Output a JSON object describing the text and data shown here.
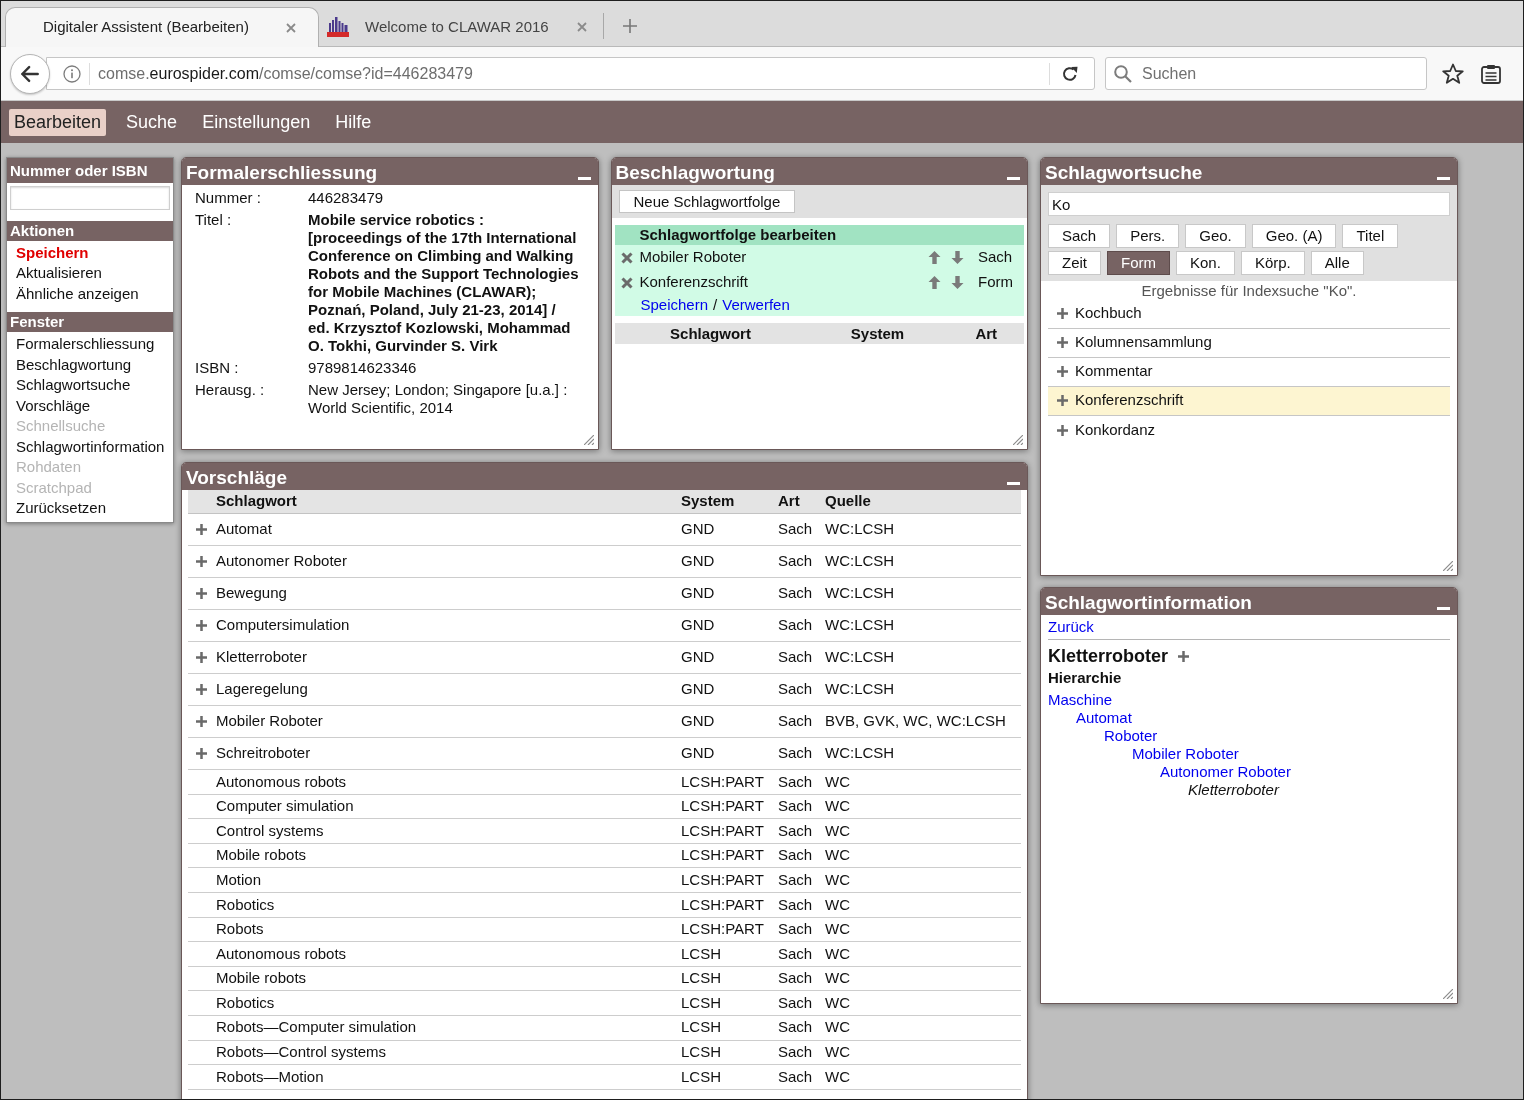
{
  "browser": {
    "tabs": [
      {
        "title": "Digitaler Assistent (Bearbeiten)",
        "selected": true,
        "favicon": false
      },
      {
        "title": "Welcome to CLAWAR 2016",
        "selected": false,
        "favicon": true
      }
    ],
    "address": {
      "subdomain": "comse.",
      "domain": "eurospider.com",
      "path": "/comse/comse?id=446283479"
    },
    "search": {
      "placeholder": "Suchen"
    }
  },
  "menu": [
    {
      "label": "Bearbeiten",
      "selected": true
    },
    {
      "label": "Suche",
      "selected": false
    },
    {
      "label": "Einstellungen",
      "selected": false
    },
    {
      "label": "Hilfe",
      "selected": false
    }
  ],
  "sidebar": {
    "lookup": {
      "title": "Nummer oder ISBN"
    },
    "sections": [
      {
        "title": "Aktionen",
        "items": [
          {
            "label": "Speichern",
            "emphasized": true,
            "disabled": false
          },
          {
            "label": "Aktualisieren",
            "emphasized": false,
            "disabled": false
          },
          {
            "label": "Ähnliche anzeigen",
            "emphasized": false,
            "disabled": false
          }
        ]
      },
      {
        "title": "Fenster",
        "items": [
          {
            "label": "Formalerschliessung",
            "emphasized": false,
            "disabled": false
          },
          {
            "label": "Beschlagwortung",
            "emphasized": false,
            "disabled": false
          },
          {
            "label": "Schlagwortsuche",
            "emphasized": false,
            "disabled": false
          },
          {
            "label": "Vorschläge",
            "emphasized": false,
            "disabled": false
          },
          {
            "label": "Schnellsuche",
            "emphasized": false,
            "disabled": true
          },
          {
            "label": "Schlagwortinformation",
            "emphasized": false,
            "disabled": false
          },
          {
            "label": "Rohdaten",
            "emphasized": false,
            "disabled": true
          },
          {
            "label": "Scratchpad",
            "emphasized": false,
            "disabled": true
          },
          {
            "label": "Zurücksetzen",
            "emphasized": false,
            "disabled": false
          }
        ]
      }
    ]
  },
  "formal": {
    "title": "Formalerschliessung",
    "fields": [
      {
        "label": "Nummer :",
        "value": "446283479",
        "bold": false
      },
      {
        "label": "Titel :",
        "value": "Mobile service robotics : [proceedings of the 17th International Conference on Climbing and Walking Robots and the Support Technologies for Mobile Machines (CLAWAR); Poznań, Poland, July 21-23, 2014] / ed. Krzysztof Kozlowski, Mohammad O. Tokhi, Gurvinder S. Virk",
        "bold": true
      },
      {
        "label": "ISBN :",
        "value": "9789814623346",
        "bold": false
      },
      {
        "label": "Herausg. :",
        "value": "New Jersey; London; Singapore [u.a.] : World Scientific, 2014",
        "bold": false
      }
    ]
  },
  "indexing": {
    "title": "Beschlagwortung",
    "new_button": "Neue Schlagwortfolge",
    "sequence": {
      "title": "Schlagwortfolge bearbeiten",
      "entries": [
        {
          "term": "Mobiler Roboter",
          "type": "Sach"
        },
        {
          "term": "Konferenzschrift",
          "type": "Form"
        }
      ],
      "save": "Speichern",
      "separator": "/",
      "discard": "Verwerfen"
    },
    "columns": [
      "Schlagwort",
      "System",
      "Art"
    ]
  },
  "keyword_search": {
    "title": "Schlagwortsuche",
    "query": "Ko",
    "filter_rows": [
      [
        {
          "label": "Sach",
          "selected": false
        },
        {
          "label": "Pers.",
          "selected": false
        },
        {
          "label": "Geo.",
          "selected": false
        },
        {
          "label": "Geo. (A)",
          "selected": false
        },
        {
          "label": "Titel",
          "selected": false
        }
      ],
      [
        {
          "label": "Zeit",
          "selected": false
        },
        {
          "label": "Form",
          "selected": true
        },
        {
          "label": "Kon.",
          "selected": false
        },
        {
          "label": "Körp.",
          "selected": false
        },
        {
          "label": "Alle",
          "selected": false
        }
      ]
    ],
    "status": "Ergebnisse für Indexsuche \"Ko\".",
    "results": [
      {
        "term": "Kochbuch",
        "selected": false
      },
      {
        "term": "Kolumnensammlung",
        "selected": false
      },
      {
        "term": "Kommentar",
        "selected": false
      },
      {
        "term": "Konferenzschrift",
        "selected": true
      },
      {
        "term": "Konkordanz",
        "selected": false
      }
    ]
  },
  "suggestions": {
    "title": "Vorschläge",
    "columns": [
      "Schlagwort",
      "System",
      "Art",
      "Quelle"
    ],
    "rows": [
      {
        "term": "Automat",
        "system": "GND",
        "type": "Sach",
        "source": "WC:LCSH",
        "addable": true
      },
      {
        "term": "Autonomer Roboter",
        "system": "GND",
        "type": "Sach",
        "source": "WC:LCSH",
        "addable": true
      },
      {
        "term": "Bewegung",
        "system": "GND",
        "type": "Sach",
        "source": "WC:LCSH",
        "addable": true
      },
      {
        "term": "Computersimulation",
        "system": "GND",
        "type": "Sach",
        "source": "WC:LCSH",
        "addable": true
      },
      {
        "term": "Kletterroboter",
        "system": "GND",
        "type": "Sach",
        "source": "WC:LCSH",
        "addable": true
      },
      {
        "term": "Lageregelung",
        "system": "GND",
        "type": "Sach",
        "source": "WC:LCSH",
        "addable": true
      },
      {
        "term": "Mobiler Roboter",
        "system": "GND",
        "type": "Sach",
        "source": "BVB, GVK, WC, WC:LCSH",
        "addable": true
      },
      {
        "term": "Schreitroboter",
        "system": "GND",
        "type": "Sach",
        "source": "WC:LCSH",
        "addable": true
      },
      {
        "term": "Autonomous robots",
        "system": "LCSH:PART",
        "type": "Sach",
        "source": "WC",
        "addable": false
      },
      {
        "term": "Computer simulation",
        "system": "LCSH:PART",
        "type": "Sach",
        "source": "WC",
        "addable": false
      },
      {
        "term": "Control systems",
        "system": "LCSH:PART",
        "type": "Sach",
        "source": "WC",
        "addable": false
      },
      {
        "term": "Mobile robots",
        "system": "LCSH:PART",
        "type": "Sach",
        "source": "WC",
        "addable": false
      },
      {
        "term": "Motion",
        "system": "LCSH:PART",
        "type": "Sach",
        "source": "WC",
        "addable": false
      },
      {
        "term": "Robotics",
        "system": "LCSH:PART",
        "type": "Sach",
        "source": "WC",
        "addable": false
      },
      {
        "term": "Robots",
        "system": "LCSH:PART",
        "type": "Sach",
        "source": "WC",
        "addable": false
      },
      {
        "term": "Autonomous robots",
        "system": "LCSH",
        "type": "Sach",
        "source": "WC",
        "addable": false
      },
      {
        "term": "Mobile robots",
        "system": "LCSH",
        "type": "Sach",
        "source": "WC",
        "addable": false
      },
      {
        "term": "Robotics",
        "system": "LCSH",
        "type": "Sach",
        "source": "WC",
        "addable": false
      },
      {
        "term": "Robots—Computer simulation",
        "system": "LCSH",
        "type": "Sach",
        "source": "WC",
        "addable": false
      },
      {
        "term": "Robots—Control systems",
        "system": "LCSH",
        "type": "Sach",
        "source": "WC",
        "addable": false
      },
      {
        "term": "Robots—Motion",
        "system": "LCSH",
        "type": "Sach",
        "source": "WC",
        "addable": false
      }
    ]
  },
  "keyword_info": {
    "title": "Schlagwortinformation",
    "back": "Zurück",
    "term": "Kletterroboter",
    "hierarchy_title": "Hierarchie",
    "hierarchy": [
      {
        "term": "Maschine",
        "current": false,
        "children": [
          {
            "term": "Automat",
            "current": false,
            "children": [
              {
                "term": "Roboter",
                "current": false,
                "children": [
                  {
                    "term": "Mobiler Roboter",
                    "current": false,
                    "children": [
                      {
                        "term": "Autonomer Roboter",
                        "current": false,
                        "children": [
                          {
                            "term": "Kletterroboter",
                            "current": true
                          }
                        ]
                      }
                    ]
                  }
                ]
              }
            ]
          }
        ]
      }
    ]
  }
}
